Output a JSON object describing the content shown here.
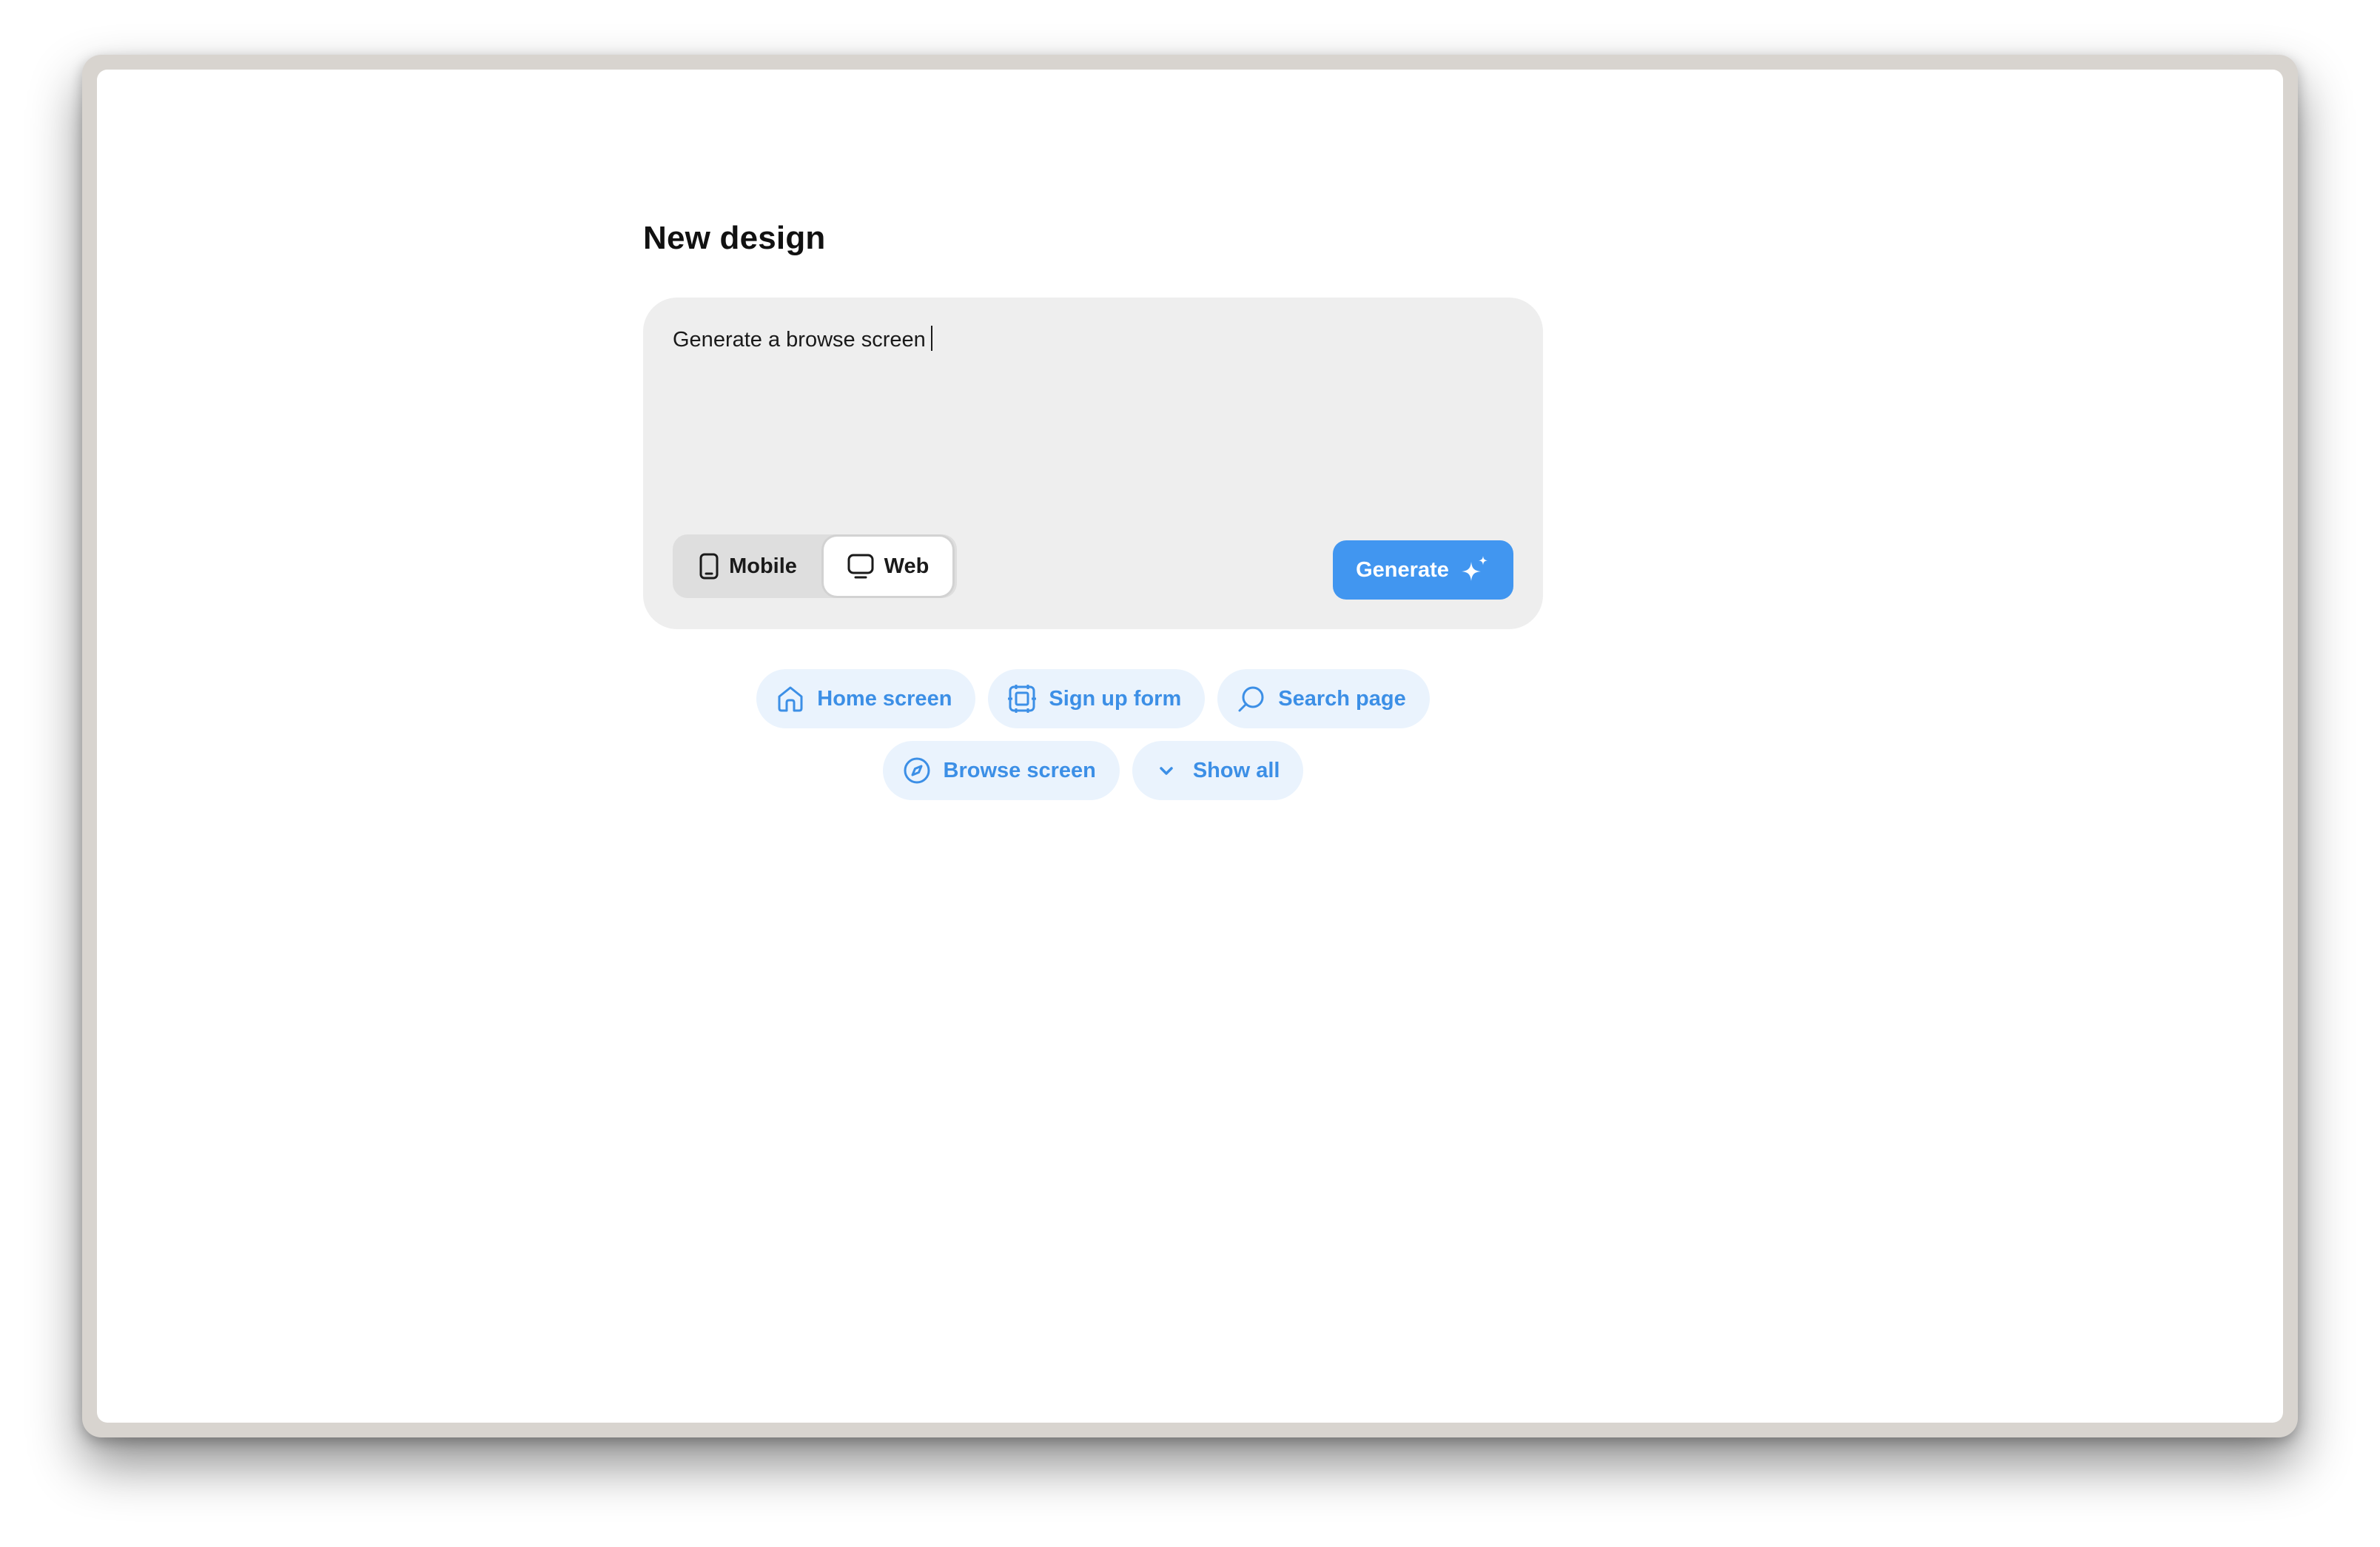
{
  "page": {
    "title": "New design"
  },
  "prompt": {
    "value": "Generate a browse screen"
  },
  "platform": {
    "options": [
      {
        "label": "Mobile",
        "icon": "phone-icon",
        "selected": false
      },
      {
        "label": "Web",
        "icon": "monitor-icon",
        "selected": true
      }
    ]
  },
  "generate": {
    "label": "Generate",
    "icon": "sparkle-icon",
    "color": "#4196f0"
  },
  "suggestions": [
    {
      "label": "Home screen",
      "icon": "home-icon"
    },
    {
      "label": "Sign up form",
      "icon": "form-icon"
    },
    {
      "label": "Search page",
      "icon": "search-icon"
    },
    {
      "label": "Browse screen",
      "icon": "compass-icon"
    },
    {
      "label": "Show all",
      "icon": "chevron-down-icon"
    }
  ],
  "colors": {
    "accent": "#4196f0",
    "chip_bg": "#eaf3fd",
    "chip_text": "#3c8fe6",
    "card_bg": "#eeeeee"
  }
}
